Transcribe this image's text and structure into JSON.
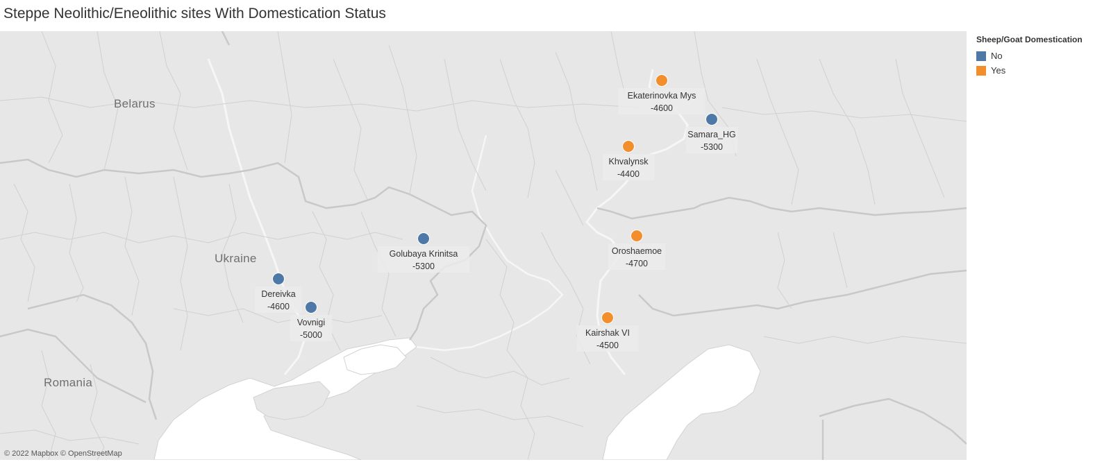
{
  "title": "Steppe Neolithic/Eneolithic sites With Domestication Status",
  "attribution": "© 2022 Mapbox © OpenStreetMap",
  "legend": {
    "title": "Sheep/Goat Domestication",
    "items": [
      {
        "label": "No",
        "color": "#4e79a7"
      },
      {
        "label": "Yes",
        "color": "#f28e2b"
      }
    ]
  },
  "map": {
    "countries": [
      {
        "name": "Belarus"
      },
      {
        "name": "Ukraine"
      },
      {
        "name": "Romania"
      }
    ]
  },
  "chart_data": {
    "type": "scatter",
    "color_field": "Sheep/Goat Domestication",
    "sites": [
      {
        "name": "Ekaterinovka Mys",
        "date": "-4600",
        "domestication": "Yes"
      },
      {
        "name": "Samara_HG",
        "date": "-5300",
        "domestication": "No"
      },
      {
        "name": "Khvalynsk",
        "date": "-4400",
        "domestication": "Yes"
      },
      {
        "name": "Oroshaemoe",
        "date": "-4700",
        "domestication": "Yes"
      },
      {
        "name": "Golubaya Krinitsa",
        "date": "-5300",
        "domestication": "No"
      },
      {
        "name": "Dereivka",
        "date": "-4600",
        "domestication": "No"
      },
      {
        "name": "Vovnigi",
        "date": "-5000",
        "domestication": "No"
      },
      {
        "name": "Kairshak VI",
        "date": "-4500",
        "domestication": "Yes"
      }
    ]
  }
}
